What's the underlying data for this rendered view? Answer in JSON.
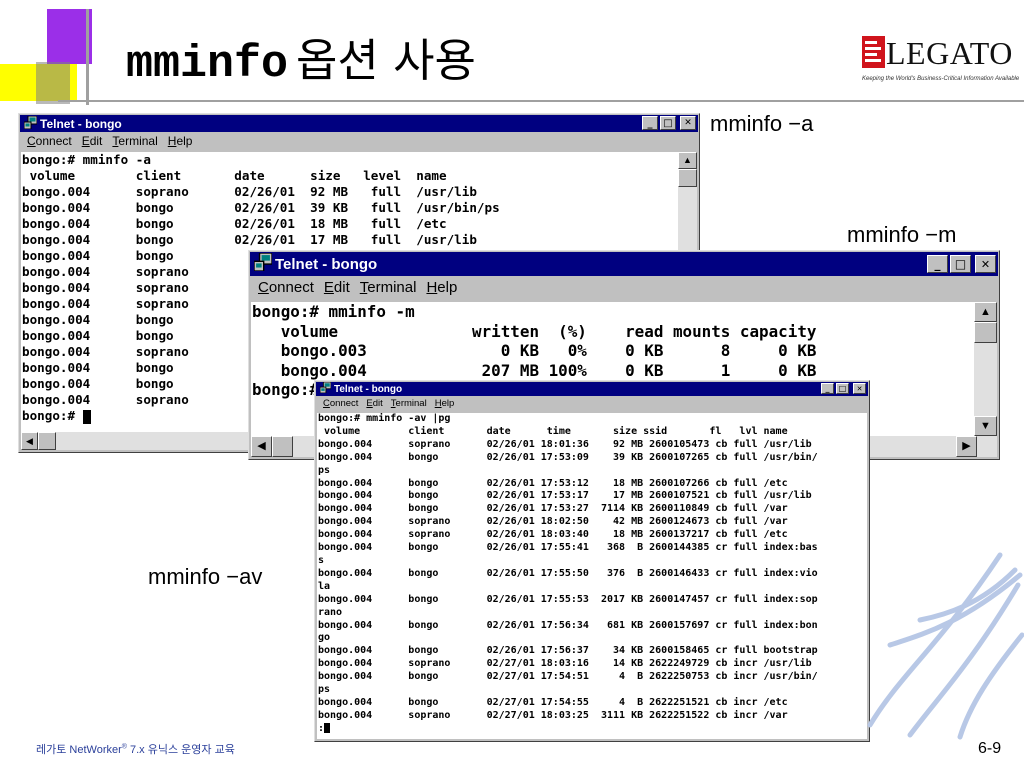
{
  "slide": {
    "title_cmd": "mminfo",
    "title_rest": "옵션 사용",
    "logo_text": "LEGATO",
    "logo_tagline": "Keeping the World's Business-Critical Information Available",
    "footer_text_prefix": "레가토 NetWorker",
    "footer_reg": "®",
    "footer_text_suffix": " 7.x 유닉스 운영자 교육",
    "page_number": "6-9",
    "label_a": "mminfo −a",
    "label_m": "mminfo −m",
    "label_av": "mminfo −av"
  },
  "windows": {
    "common": {
      "title": "Telnet - bongo",
      "menu": [
        {
          "first": "C",
          "rest": "onnect"
        },
        {
          "first": "E",
          "rest": "dit"
        },
        {
          "first": "T",
          "rest": "erminal"
        },
        {
          "first": "H",
          "rest": "elp"
        }
      ],
      "min_glyph": "_",
      "max_glyph": "□",
      "close_glyph": "✕",
      "scroll_up": "▲",
      "scroll_down": "▼",
      "scroll_left": "◀",
      "scroll_right": "▶"
    },
    "win_a": {
      "lines": [
        "bongo:# mminfo -a",
        " volume        client       date      size   level  name",
        "bongo.004      soprano      02/26/01  92 MB   full  /usr/lib",
        "bongo.004      bongo        02/26/01  39 KB   full  /usr/bin/ps",
        "bongo.004      bongo        02/26/01  18 MB   full  /etc",
        "bongo.004      bongo        02/26/01  17 MB   full  /usr/lib",
        "bongo.004      bongo",
        "bongo.004      soprano",
        "bongo.004      soprano",
        "bongo.004      soprano",
        "bongo.004      bongo",
        "bongo.004      bongo",
        "bongo.004      soprano",
        "bongo.004      bongo",
        "bongo.004      bongo",
        "bongo.004      soprano"
      ],
      "prompt": "bongo:# "
    },
    "win_m": {
      "lines": [
        "bongo:# mminfo -m",
        "   volume              written  (%)    read mounts capacity",
        "   bongo.003              0 KB   0%    0 KB      8     0 KB",
        "   bongo.004            207 MB 100%    0 KB      1     0 KB"
      ],
      "prompt": "bongo:#"
    },
    "win_av": {
      "lines": [
        "bongo:# mminfo -av |pg",
        " volume        client       date      time       size ssid       fl   lvl name",
        "bongo.004      soprano      02/26/01 18:01:36    92 MB 2600105473 cb full /usr/lib",
        "bongo.004      bongo        02/26/01 17:53:09    39 KB 2600107265 cb full /usr/bin/",
        "ps",
        "bongo.004      bongo        02/26/01 17:53:12    18 MB 2600107266 cb full /etc",
        "bongo.004      bongo        02/26/01 17:53:17    17 MB 2600107521 cb full /usr/lib",
        "bongo.004      bongo        02/26/01 17:53:27  7114 KB 2600110849 cb full /var",
        "bongo.004      soprano      02/26/01 18:02:50    42 MB 2600124673 cb full /var",
        "bongo.004      soprano      02/26/01 18:03:40    18 MB 2600137217 cb full /etc",
        "bongo.004      bongo        02/26/01 17:55:41   368  B 2600144385 cr full index:bas",
        "s",
        "bongo.004      bongo        02/26/01 17:55:50   376  B 2600146433 cr full index:vio",
        "la",
        "bongo.004      bongo        02/26/01 17:55:53  2017 KB 2600147457 cr full index:sop",
        "rano",
        "bongo.004      bongo        02/26/01 17:56:34   681 KB 2600157697 cr full index:bon",
        "go",
        "bongo.004      bongo        02/26/01 17:56:37    34 KB 2600158465 cr full bootstrap",
        "bongo.004      soprano      02/27/01 18:03:16    14 KB 2622249729 cb incr /usr/lib",
        "bongo.004      bongo        02/27/01 17:54:51     4  B 2622250753 cb incr /usr/bin/",
        "ps",
        "bongo.004      bongo        02/27/01 17:54:55     4  B 2622251521 cb incr /etc",
        "bongo.004      soprano      02/27/01 18:03:25  3111 KB 2622251522 cb incr /var"
      ],
      "prompt": ":"
    }
  }
}
